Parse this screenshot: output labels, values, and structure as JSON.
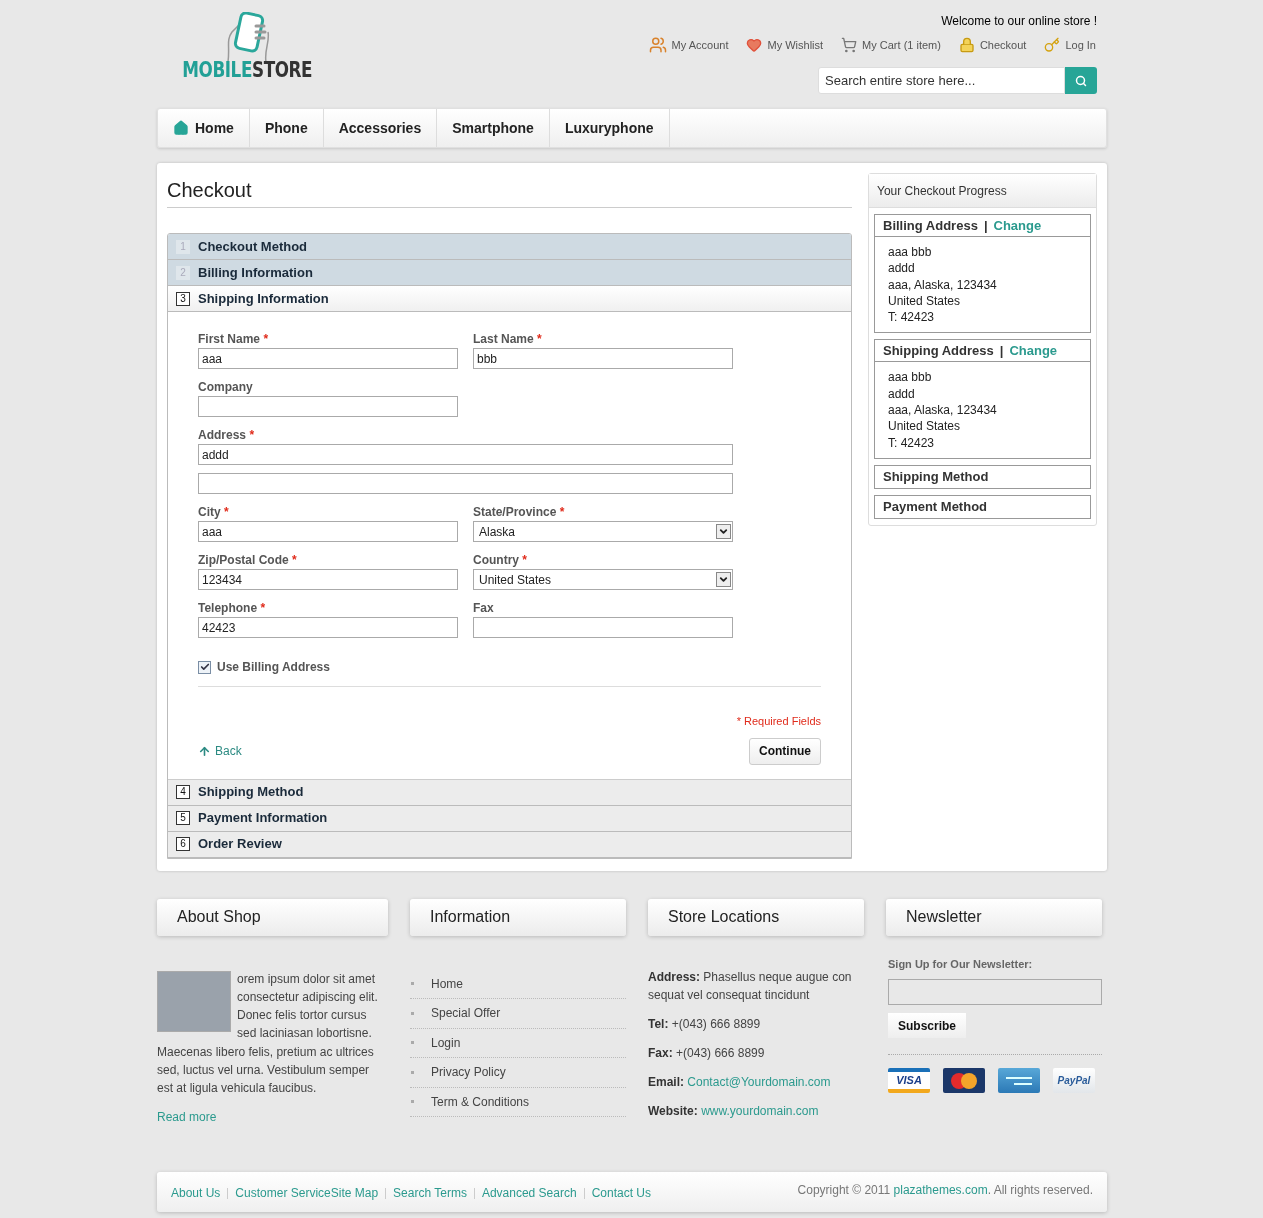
{
  "header": {
    "logo": {
      "part1": "MOBILE",
      "part2": "STORE"
    },
    "welcome": "Welcome to our online store !",
    "links": [
      {
        "kind": "account",
        "label": "My Account"
      },
      {
        "kind": "wishlist",
        "label": "My Wishlist"
      },
      {
        "kind": "cart",
        "label": "My Cart (1 item)"
      },
      {
        "kind": "checkout",
        "label": "Checkout"
      },
      {
        "kind": "login",
        "label": "Log In"
      }
    ],
    "search": {
      "placeholder": "Search entire store here..."
    }
  },
  "nav": [
    {
      "label": "Home",
      "home": true
    },
    {
      "label": "Phone",
      "home": false
    },
    {
      "label": "Accessories",
      "home": false
    },
    {
      "label": "Smartphone",
      "home": false
    },
    {
      "label": "Luxuryphone",
      "home": false
    }
  ],
  "checkout": {
    "title": "Checkout",
    "steps": [
      {
        "number": "1",
        "title": "Checkout Method",
        "completed": true,
        "selected": false
      },
      {
        "number": "2",
        "title": "Billing Information",
        "completed": true,
        "selected": false
      },
      {
        "number": "3",
        "title": "Shipping Information",
        "completed": false,
        "selected": true
      },
      {
        "number": "4",
        "title": "Shipping Method",
        "completed": false,
        "selected": false
      },
      {
        "number": "5",
        "title": "Payment Information",
        "completed": false,
        "selected": false
      },
      {
        "number": "6",
        "title": "Order Review",
        "completed": false,
        "selected": false
      }
    ],
    "form": {
      "required_mark": "*",
      "rows": [
        [
          {
            "kind": "text",
            "label": "First Name",
            "required": true,
            "value": "aaa"
          },
          {
            "kind": "text",
            "label": "Last Name",
            "required": true,
            "value": "bbb"
          }
        ],
        [
          {
            "kind": "text",
            "label": "Company",
            "required": false
          }
        ],
        [
          {
            "kind": "wide",
            "label": "Address",
            "required": true,
            "value": "addd"
          }
        ],
        [
          {
            "kind": "wide"
          }
        ],
        [
          {
            "kind": "text",
            "label": "City",
            "required": true,
            "value": "aaa"
          },
          {
            "kind": "select",
            "label": "State/Province",
            "required": true,
            "value": "Alaska"
          }
        ],
        [
          {
            "kind": "text",
            "label": "Zip/Postal Code",
            "required": true,
            "value": "123434"
          },
          {
            "kind": "select",
            "label": "Country",
            "required": true,
            "value": "United States"
          }
        ],
        [
          {
            "kind": "text",
            "label": "Telephone",
            "required": true,
            "value": "42423"
          },
          {
            "kind": "text",
            "label": "Fax",
            "required": false
          }
        ]
      ],
      "use_billing": {
        "label": "Use Billing Address",
        "checked": true
      },
      "required_note": "* Required Fields",
      "back": "Back",
      "continue": "Continue"
    }
  },
  "progress": {
    "title": "Your Checkout Progress",
    "sections": [
      {
        "title": "Billing Address",
        "separator": "|",
        "link": "Change",
        "lines": [
          "aaa bbb",
          "addd",
          "aaa, Alaska, 123434",
          "United States",
          "T: 42423"
        ]
      },
      {
        "title": "Shipping Address",
        "separator": "|",
        "link": "Change",
        "lines": [
          "aaa bbb",
          "addd",
          "aaa, Alaska, 123434",
          "United States",
          "T: 42423"
        ]
      },
      {
        "title": "Shipping Method"
      },
      {
        "title": "Payment Method"
      }
    ]
  },
  "footer": {
    "about": {
      "title": "About Shop",
      "text_beside": "orem ipsum dolor sit amet consectetur adipiscing elit. Donec felis tortor cursus sed laciniasan lobortisne.",
      "text_below": "Maecenas libero felis, pretium ac ultrices sed, luctus vel urna. Vestibulum semper est at ligula vehicula faucibus.",
      "read_more": "Read more"
    },
    "information": {
      "title": "Information",
      "links": [
        "Home",
        "Special Offer",
        "Login",
        "Privacy Policy",
        "Term & Conditions"
      ]
    },
    "locations": {
      "title": "Store Locations",
      "lines": [
        {
          "label": "Address:",
          "text": "Phasellus neque augue con sequat vel consequat tincidunt",
          "link": false
        },
        {
          "label": "Tel:",
          "text": "+(043) 666 8899",
          "link": false
        },
        {
          "label": "Fax:",
          "text": "+(043) 666 8899",
          "link": false
        },
        {
          "label": "Email:",
          "text": "Contact@Yourdomain.com",
          "link": true
        },
        {
          "label": "Website:",
          "text": "www.yourdomain.com",
          "link": true
        }
      ]
    },
    "newsletter": {
      "title": "Newsletter",
      "label": "Sign Up for Our Newsletter:",
      "button": "Subscribe",
      "cards": [
        {
          "kind": "visa",
          "text": "VISA"
        },
        {
          "kind": "mastercard"
        },
        {
          "kind": "amex"
        },
        {
          "kind": "paypal",
          "text": "PayPal"
        }
      ]
    },
    "bottom_links": [
      "About Us",
      "Customer ServiceSite Map",
      "Search Terms",
      "Advanced Search",
      "Contact Us"
    ],
    "copyright": {
      "before": "Copyright © 2011 ",
      "link": "plazathemes.com",
      "after": ". All rights reserved."
    }
  }
}
